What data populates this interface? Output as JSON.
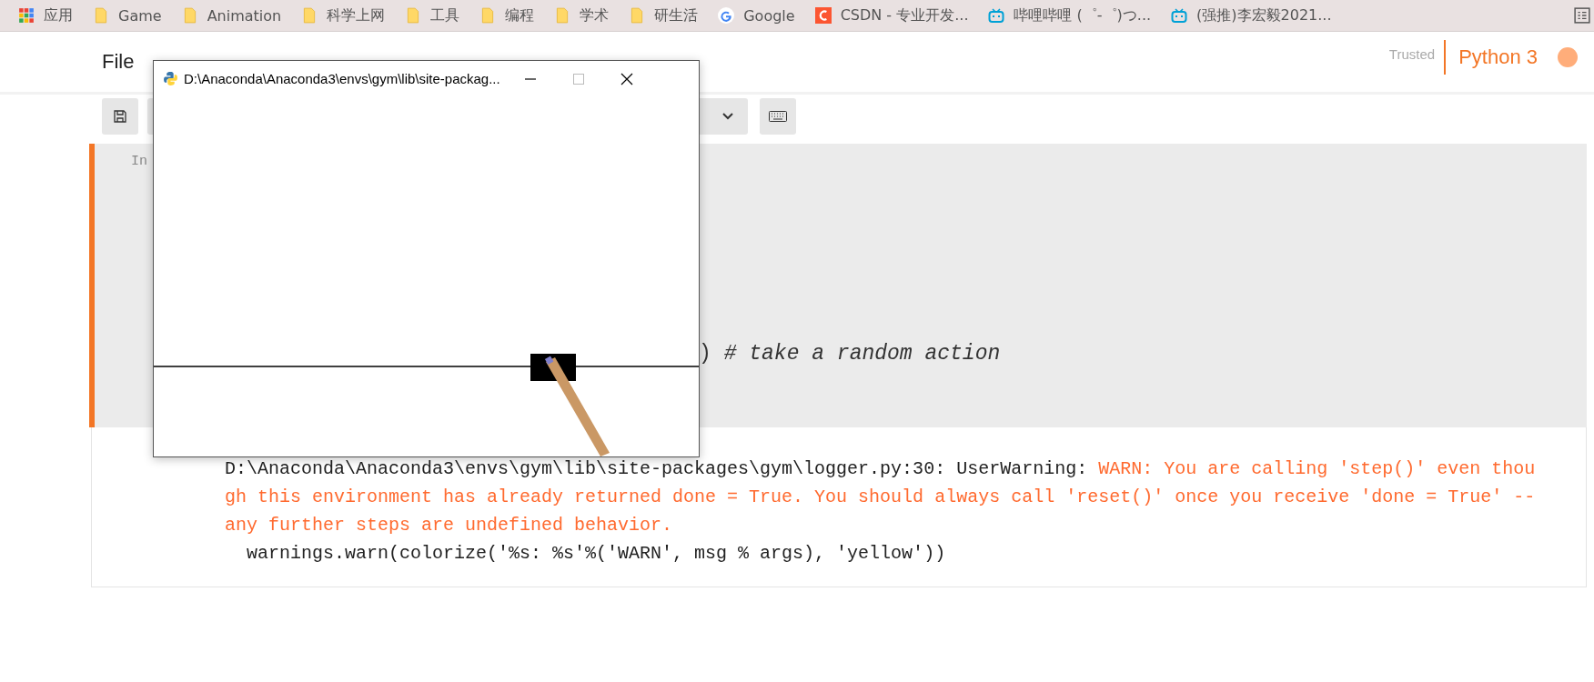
{
  "bookmarks": [
    {
      "kind": "apps",
      "label": "应用"
    },
    {
      "kind": "folder",
      "label": "Game"
    },
    {
      "kind": "folder",
      "label": "Animation"
    },
    {
      "kind": "folder",
      "label": "科学上网"
    },
    {
      "kind": "folder",
      "label": "工具"
    },
    {
      "kind": "folder",
      "label": "编程"
    },
    {
      "kind": "folder",
      "label": "学术"
    },
    {
      "kind": "folder",
      "label": "研生活"
    },
    {
      "kind": "google",
      "label": "Google"
    },
    {
      "kind": "csdn",
      "label": "CSDN - 专业开发..."
    },
    {
      "kind": "bili",
      "label": "哔哩哔哩 (゜-゜)つ..."
    },
    {
      "kind": "bili",
      "label": "(强推)李宏毅2021..."
    }
  ],
  "menu": [
    "File"
  ],
  "trusted": "Trusted",
  "kernel": {
    "name": "Python 3"
  },
  "cell": {
    "prompt": "In",
    "code": ") *# take a random action*"
  },
  "output": [
    [
      {
        "kind": "plain",
        "text": "D:\\Anaconda\\Anaconda3\\envs\\gym\\lib\\site-packages\\gym\\logger.py:30: UserWarning: "
      },
      {
        "kind": "warn",
        "text": "WARN: You are calling 'step()' even thou"
      }
    ],
    [
      {
        "kind": "warn",
        "text": "gh this environment has already returned done = True. You should always call 'reset()' once you receive 'done = True' --"
      }
    ],
    [
      {
        "kind": "warn",
        "text": "any further steps are undefined behavior."
      }
    ],
    [
      {
        "kind": "plain",
        "text": "  warnings.warn(colorize('%s: %s'%('WARN', msg % args), 'yellow'))"
      }
    ]
  ],
  "window": {
    "title": "D:\\Anaconda\\Anaconda3\\envs\\gym\\lib\\site-packag..."
  }
}
